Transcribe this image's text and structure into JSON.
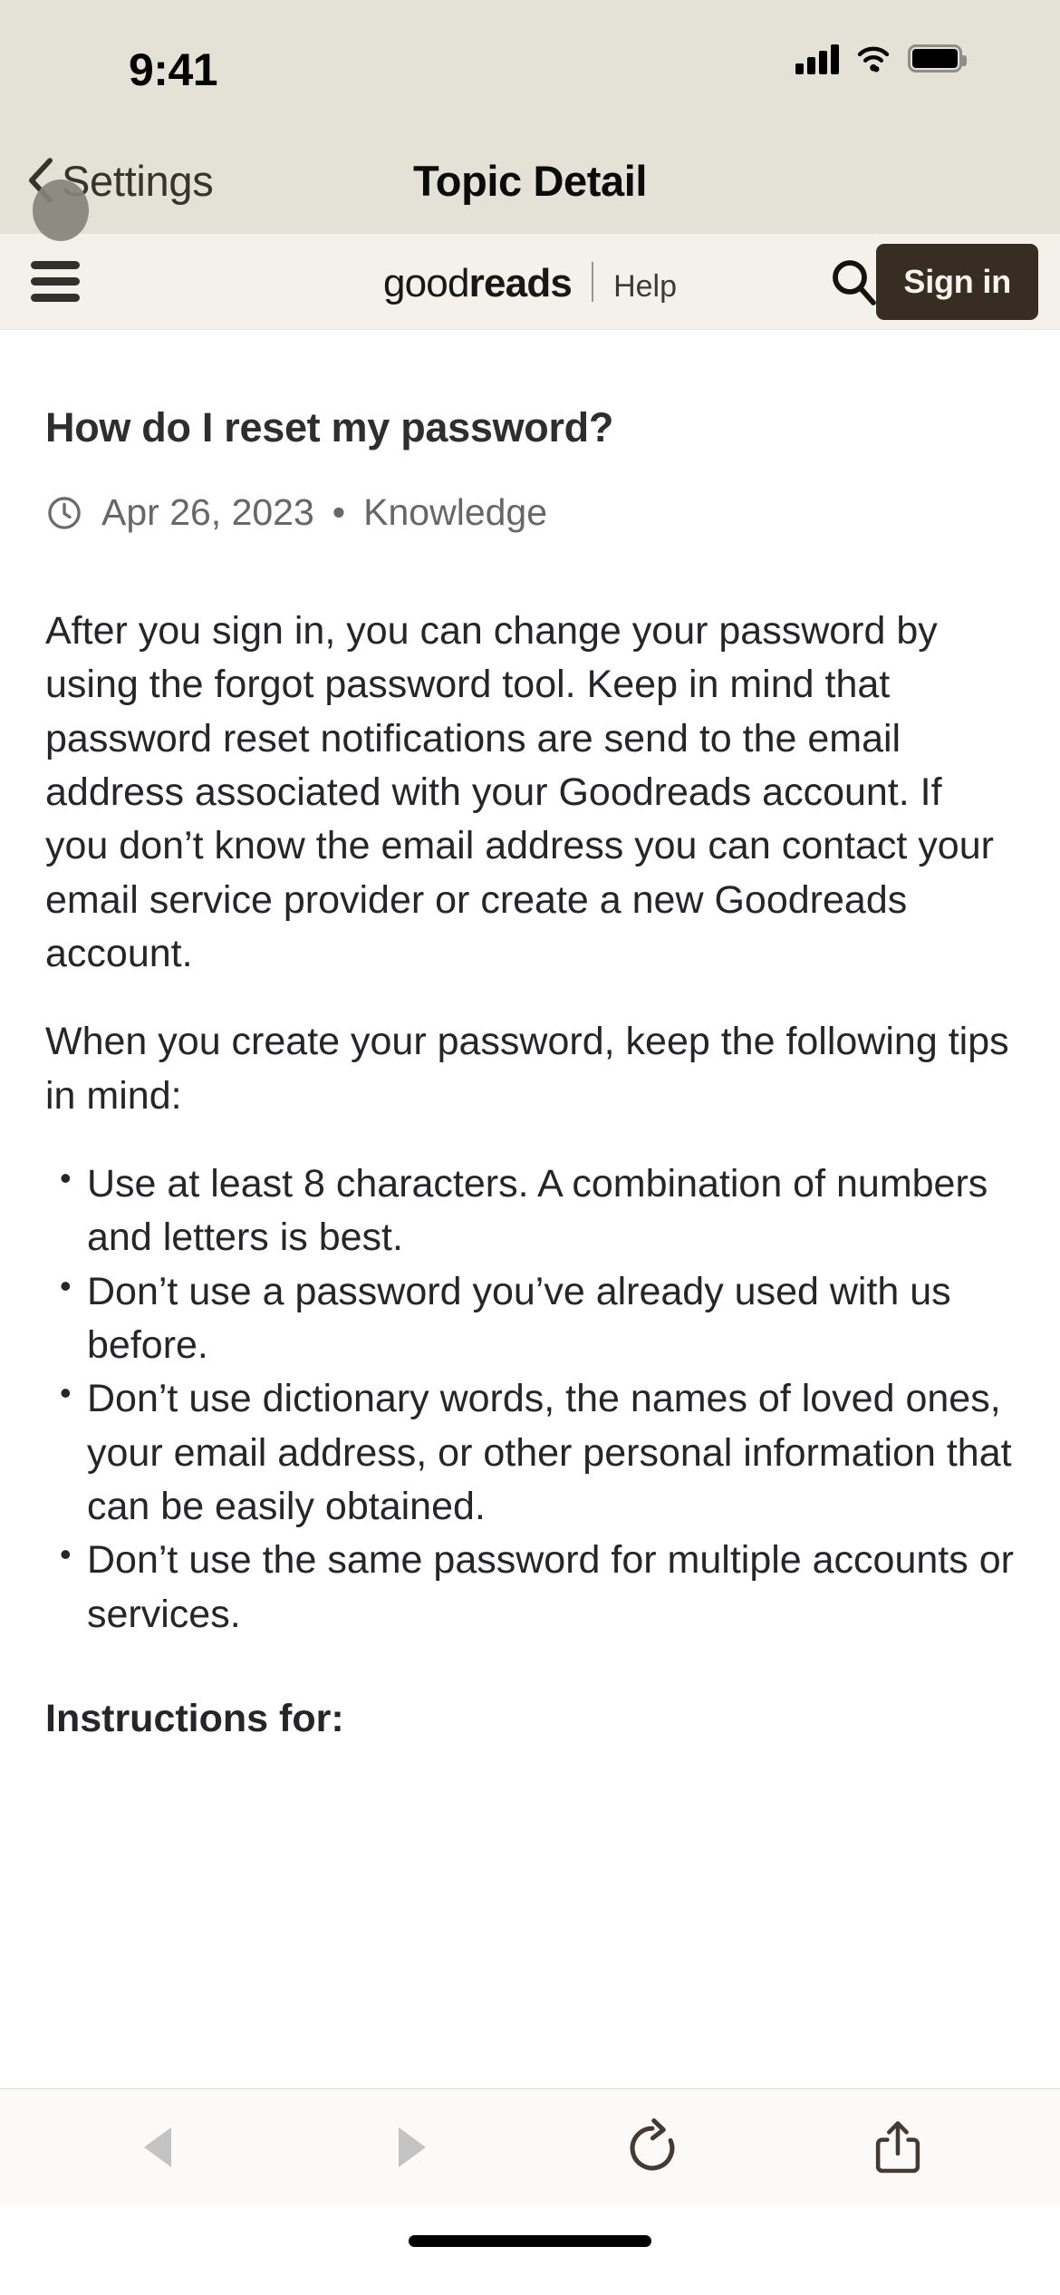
{
  "status_bar": {
    "time": "9:41",
    "cellular_icon": "cellular-signal-icon",
    "wifi_icon": "wifi-icon",
    "battery_icon": "battery-icon"
  },
  "ios_nav": {
    "back_label": "Settings",
    "back_icon": "chevron-left-icon",
    "title": "Topic Detail",
    "touch_indicator": "touch-indicator"
  },
  "site_header": {
    "menu_icon": "hamburger-menu-icon",
    "logo_light": "good",
    "logo_bold": "reads",
    "help_label": "Help",
    "search_icon": "search-icon",
    "signin_label": "Sign in",
    "signin_bg": "#382d23",
    "header_bg": "#f4f1ea"
  },
  "article": {
    "title": "How do I reset my password?",
    "date_icon": "clock-icon",
    "date": "Apr 26, 2023",
    "separator": "•",
    "category": "Knowledge",
    "paragraph_1": "After you sign in, you can change your password by using the forgot password tool. Keep in mind that password reset notifications are send to the email address associated with your Goodreads account. If you don’t know the email address you can contact your email service provider or create a new Goodreads account.",
    "paragraph_2": "When you create your password, keep the following tips in mind:",
    "tips": [
      "Use at least 8 characters. A combination of numbers and letters is best.",
      "Don’t use a password you’ve already used with us before.",
      "Don’t use dictionary words, the names of loved ones, your email address, or other personal information that can be easily obtained.",
      "Don’t use the same password for multiple accounts or services."
    ],
    "section_heading": "Instructions for:"
  },
  "toolbar": {
    "back_icon": "back-triangle-icon",
    "forward_icon": "forward-triangle-icon",
    "reload_icon": "reload-icon",
    "share_icon": "share-icon",
    "disabled_color": "#c3c3c3",
    "active_color": "#453a32"
  },
  "home_indicator": "home-indicator"
}
